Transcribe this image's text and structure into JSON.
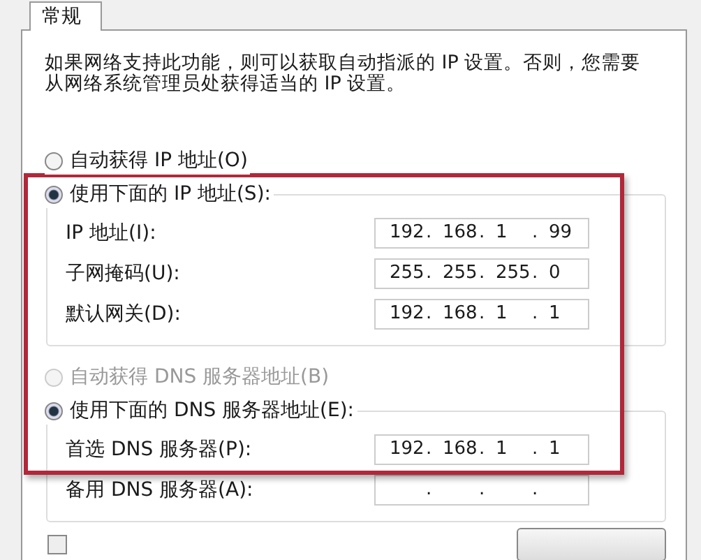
{
  "tabs": [
    {
      "label": "常规",
      "selected": true
    }
  ],
  "description": "如果网络支持此功能，则可以获取自动指派的 IP 设置。否则，您需要从网络系统管理员处获得适当的 IP 设置。",
  "separator": ".",
  "ip_mode": [
    {
      "label": "自动获得 IP 地址(O)",
      "selected": false,
      "disabled": false
    },
    {
      "label": "使用下面的 IP 地址(S):",
      "selected": true,
      "disabled": false
    }
  ],
  "ip_fields": [
    {
      "label": "IP 地址(I):",
      "segments": [
        "192",
        "168",
        "1",
        "99"
      ]
    },
    {
      "label": "子网掩码(U):",
      "segments": [
        "255",
        "255",
        "255",
        "0"
      ]
    },
    {
      "label": "默认网关(D):",
      "segments": [
        "192",
        "168",
        "1",
        "1"
      ]
    }
  ],
  "dns_mode": [
    {
      "label": "自动获得 DNS 服务器地址(B)",
      "selected": false,
      "disabled": true
    },
    {
      "label": "使用下面的 DNS 服务器地址(E):",
      "selected": true,
      "disabled": false
    }
  ],
  "dns_fields": [
    {
      "label": "首选 DNS 服务器(P):",
      "segments": [
        "192",
        "168",
        "1",
        "1"
      ]
    },
    {
      "label": "备用 DNS 服务器(A):"
    }
  ],
  "validate_on_exit": {
    "checked": false
  }
}
